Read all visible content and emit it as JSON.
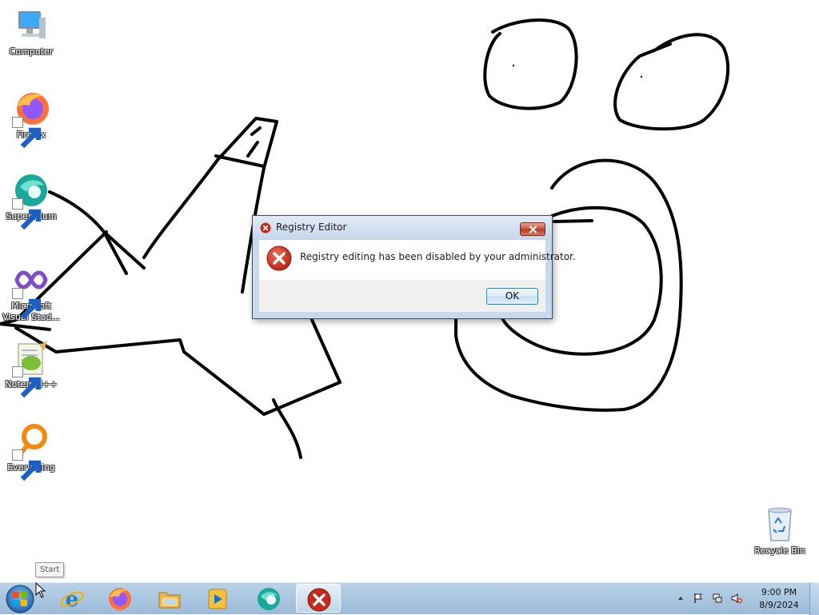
{
  "desktop": {
    "icons": [
      {
        "label": "Computer",
        "icon": "computer-icon",
        "shortcut": false
      },
      {
        "label": "Firefox",
        "icon": "firefox-icon",
        "shortcut": true
      },
      {
        "label": "Supermium",
        "icon": "supermium-icon",
        "shortcut": true
      },
      {
        "label": "Microsoft Visual Stud...",
        "icon": "visual-studio-icon",
        "shortcut": true
      },
      {
        "label": "Notepad++",
        "icon": "notepad-plus-plus-icon",
        "shortcut": true
      },
      {
        "label": "Everything",
        "icon": "everything-search-icon",
        "shortcut": true
      },
      {
        "label": "Recycle Bin",
        "icon": "recycle-bin-icon",
        "shortcut": false
      }
    ],
    "wallpaper_drawing": "hand-drawn black line sketch"
  },
  "dialog": {
    "title": "Registry Editor",
    "message": "Registry editing has been disabled by your administrator.",
    "ok_label": "OK",
    "icon": "error-icon"
  },
  "tooltip": {
    "text": "Start"
  },
  "taskbar": {
    "start": "windows-start-orb",
    "pinned": [
      {
        "name": "internet-explorer-icon"
      },
      {
        "name": "firefox-icon"
      },
      {
        "name": "file-explorer-icon"
      },
      {
        "name": "media-player-icon"
      },
      {
        "name": "supermium-icon"
      },
      {
        "name": "error-icon",
        "active": true
      }
    ],
    "tray_icons": [
      "show-hidden-icons",
      "action-center-flag-icon",
      "network-icon",
      "volume-muted-icon"
    ],
    "clock": {
      "time": "9:00 PM",
      "date": "8/9/2024"
    }
  },
  "colors": {
    "taskbar": "#a9c6e2",
    "dialog_frame": "#cad9ec",
    "error_red": "#c42b1c",
    "ok_border": "#3c7fb1"
  }
}
